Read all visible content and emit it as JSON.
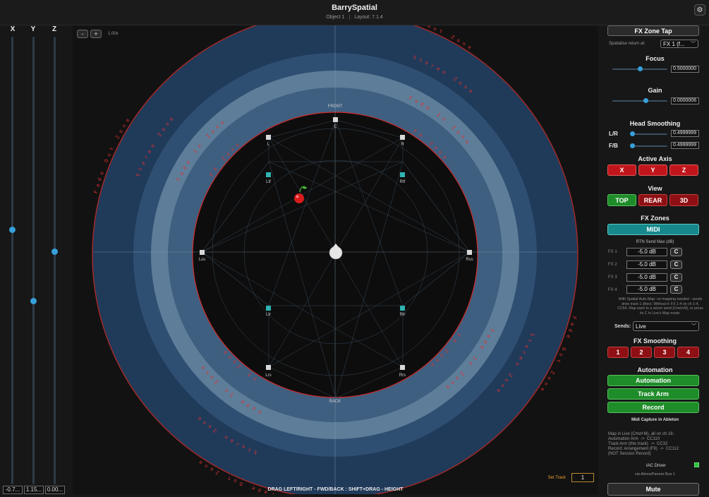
{
  "header": {
    "title": "BarrySpatial",
    "object": "Object 1",
    "layout": "Layout: 7.1.4",
    "gear_icon": "gear-icon"
  },
  "left": {
    "axes": [
      {
        "label": "X",
        "value": "-0.7...",
        "level": 0.57
      },
      {
        "label": "Y",
        "value": "1.15...",
        "level": 0.41
      },
      {
        "label": "Z",
        "value": "0.00...",
        "level": 0.52
      }
    ]
  },
  "canvas": {
    "zoom_minus": "-",
    "zoom_plus": "+",
    "zoom_level": "1.00x",
    "front_label": "FRONT",
    "back_label": "BACK",
    "ring_fade": "Fade Out Zone",
    "ring_stereo": "Stereo Zone",
    "ring_fadein": "Fade In Zone",
    "ring_fx": "FX Zone",
    "speakers": [
      {
        "name": "C",
        "color": "#d8d8d8"
      },
      {
        "name": "L",
        "color": "#d8d8d8"
      },
      {
        "name": "R",
        "color": "#d8d8d8"
      },
      {
        "name": "Ltf",
        "color": "#2fb3b3"
      },
      {
        "name": "Rtf",
        "color": "#2fb3b3"
      },
      {
        "name": "Lss",
        "color": "#d8d8d8"
      },
      {
        "name": "Rss",
        "color": "#d8d8d8"
      },
      {
        "name": "Ltr",
        "color": "#2fb3b3"
      },
      {
        "name": "Rtr",
        "color": "#2fb3b3"
      },
      {
        "name": "Lrs",
        "color": "#d8d8d8"
      },
      {
        "name": "Rrs",
        "color": "#d8d8d8"
      }
    ],
    "object_icon": "cherry-icon",
    "listener_icon": "listener-head-icon",
    "hint": "DRAG LEFT/RIGHT - FWD/BACK : SHIFT+DRAG - HEIGHT",
    "set_track_label": "Set Track",
    "set_track_value": "1"
  },
  "right": {
    "fx_zone_tap": "FX Zone Tap",
    "spatialise_label": "Spatialise return at:",
    "spatialise_value": "FX 1 (f...",
    "focus_title": "Focus",
    "focus_value": "0.5000000",
    "focus_level": 0.5,
    "gain_title": "Gain",
    "gain_value": "0.0000006",
    "gain_level": 0.6,
    "head_smoothing_title": "Head Smoothing",
    "lr_label": "L/R",
    "lr_value": "0.4999999",
    "lr_level": 0.0,
    "fb_label": "F/B",
    "fb_value": "0.4999999",
    "fb_level": 0.0,
    "active_axis_title": "Active Axis",
    "axis_buttons": [
      "X",
      "Y",
      "Z"
    ],
    "view_title": "View",
    "view_buttons": [
      "TOP",
      "REAR",
      "3D"
    ],
    "fx_zones_title": "FX Zones",
    "midi_button": "MIDI",
    "rtn_title": "RTN Send Max (dB)",
    "fx_rows": [
      {
        "label": "FX 1",
        "value": "-5.0 dB",
        "c": "C"
      },
      {
        "label": "FX 2",
        "value": "-5.0 dB",
        "c": "C"
      },
      {
        "label": "FX 3",
        "value": "-5.0 dB",
        "c": "C"
      },
      {
        "label": "FX 4",
        "value": "-5.0 dB",
        "c": "C"
      }
    ],
    "help_text": "With Spatial Auto-Map: no mapping needed - sends drive track 1 direct. Without it: FX 1-4 on ch 1-4, CC64. Map each to a return send (Cmd+M), or press its C in Live's Map mode.",
    "sends_label": "Sends:",
    "sends_value": "Live",
    "fx_smoothing_title": "FX Smoothing",
    "smoothing_buttons": [
      "1",
      "2",
      "3",
      "4"
    ],
    "automation_title": "Automation",
    "automation_button": "Automation",
    "track_arm_button": "Track Arm",
    "record_button": "Record",
    "midi_capture_title": "Midi Capture in Ableton",
    "midi_lines": "Map in Live (Cmd+M), all on ch 16:\nAutomation Arm  ->  CC110\nTrack Arm (this track)  ->  CC32\nRecord: Arrangement (F9)  ->  CC112\n(NOT Session Record)",
    "iac_label": "IAC Driver",
    "iac_sub": "via AtmosPanner Bus 1",
    "mute_button": "Mute"
  }
}
